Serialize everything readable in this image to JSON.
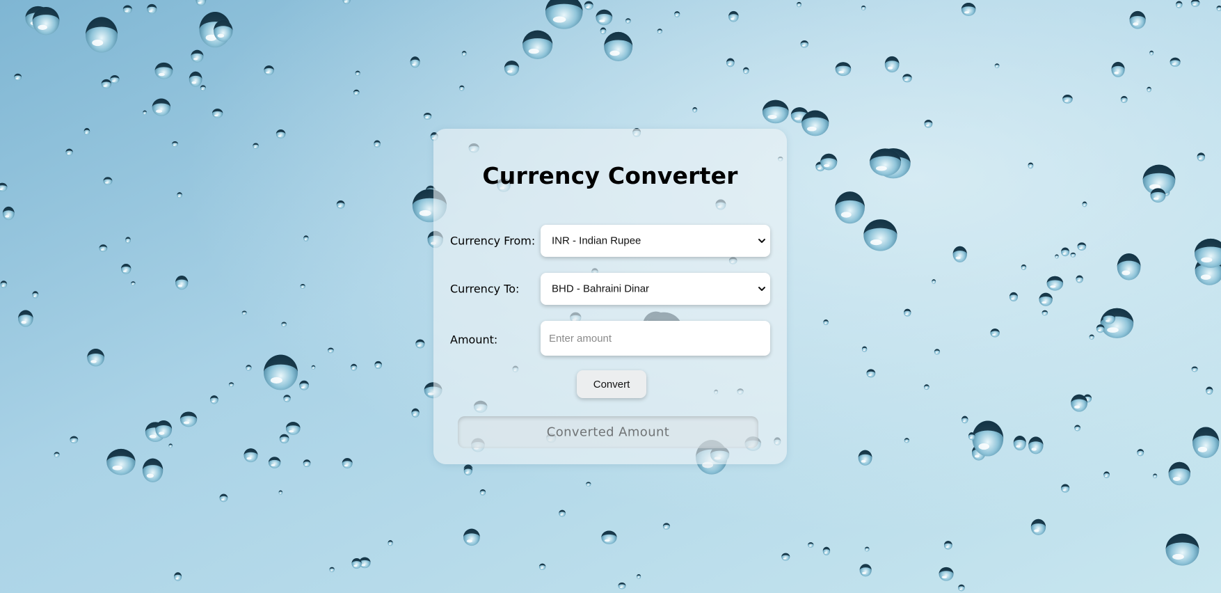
{
  "background": {
    "theme": "raindrops-on-glass",
    "sky_color": "#a9d2e6",
    "light_color": "#c8e6ef",
    "drop_color": "#0e2a3a"
  },
  "converter": {
    "title": "Currency Converter",
    "from": {
      "label": "Currency From:",
      "selected": "INR - Indian Rupee",
      "icon": "chevron-down-icon"
    },
    "to": {
      "label": "Currency To:",
      "selected": "BHD - Bahraini Dinar",
      "icon": "chevron-down-icon"
    },
    "amount": {
      "label": "Amount:",
      "value": "",
      "placeholder": "Enter amount"
    },
    "convert_button": "Convert",
    "result": "Converted Amount"
  }
}
